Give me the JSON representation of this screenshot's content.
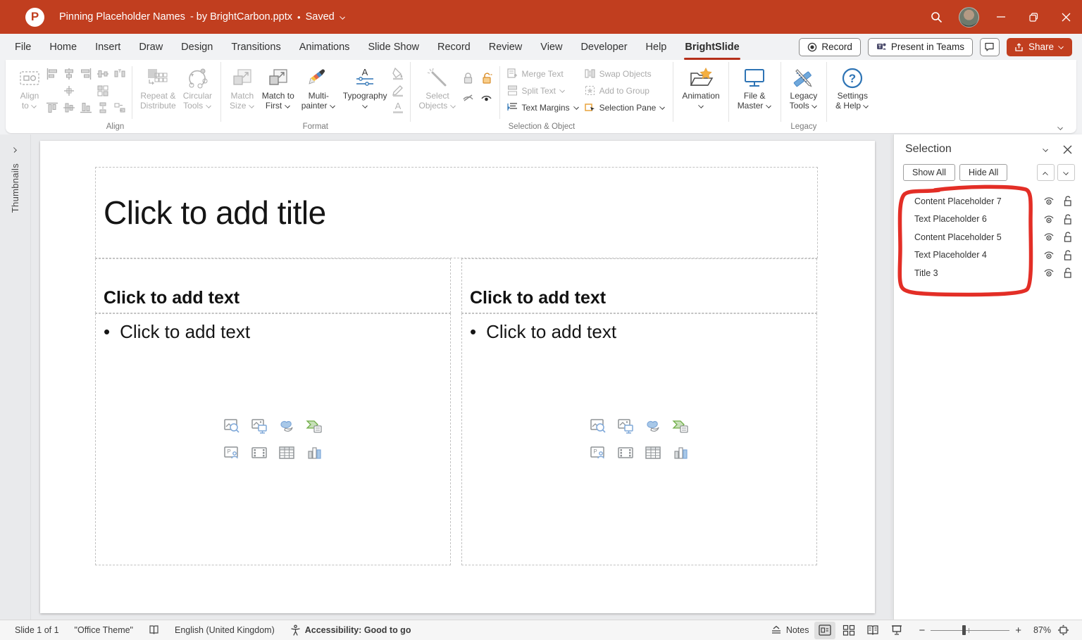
{
  "window": {
    "title": "Pinning Placeholder Names",
    "title_suffix": "- by BrightCarbon.pptx",
    "saved_status": "Saved"
  },
  "menu": {
    "tabs": [
      "File",
      "Home",
      "Insert",
      "Draw",
      "Design",
      "Transitions",
      "Animations",
      "Slide Show",
      "Record",
      "Review",
      "View",
      "Developer",
      "Help",
      "BrightSlide"
    ],
    "active_tab": "BrightSlide",
    "record": "Record",
    "present_in_teams": "Present in Teams",
    "share": "Share"
  },
  "ribbon": {
    "align_group": {
      "label": "Align",
      "align_to_1": "Align",
      "align_to_2": "to",
      "repeat_1": "Repeat &",
      "repeat_2": "Distribute",
      "circular_1": "Circular",
      "circular_2": "Tools"
    },
    "format_group": {
      "label": "Format",
      "match_size_1": "Match",
      "match_size_2": "Size",
      "match_first_1": "Match to",
      "match_first_2": "First",
      "multi_1": "Multi-",
      "multi_2": "painter",
      "typography": "Typography"
    },
    "selection_group": {
      "label": "Selection & Object",
      "select_1": "Select",
      "select_2": "Objects",
      "merge_text": "Merge Text",
      "split_text": "Split Text",
      "text_margins": "Text Margins",
      "swap_objects": "Swap Objects",
      "add_to_group": "Add to Group",
      "selection_pane": "Selection Pane"
    },
    "animation": "Animation",
    "file_master_1": "File &",
    "file_master_2": "Master",
    "legacy_group": {
      "label": "Legacy",
      "tools_1": "Legacy",
      "tools_2": "Tools"
    },
    "settings_1": "Settings",
    "settings_2": "& Help"
  },
  "slide": {
    "title_placeholder": "Click to add title",
    "heading_placeholder": "Click to add text",
    "body_placeholder": "Click to add text",
    "bullet": "•"
  },
  "selection_pane": {
    "title": "Selection",
    "show_all": "Show All",
    "hide_all": "Hide All",
    "items": [
      "Content Placeholder 7",
      "Text Placeholder 6",
      "Content Placeholder 5",
      "Text Placeholder 4",
      "Title 3"
    ]
  },
  "status": {
    "slide_count": "Slide 1 of 1",
    "theme": "\"Office Theme\"",
    "language": "English (United Kingdom)",
    "accessibility": "Accessibility: Good to go",
    "notes": "Notes",
    "zoom_percent": "87%"
  },
  "colors": {
    "titlebar_red": "#C13E1F",
    "annotation_red": "#E11E15",
    "accent_blue": "#2E74B5",
    "accent_orange": "#EFA13C"
  }
}
